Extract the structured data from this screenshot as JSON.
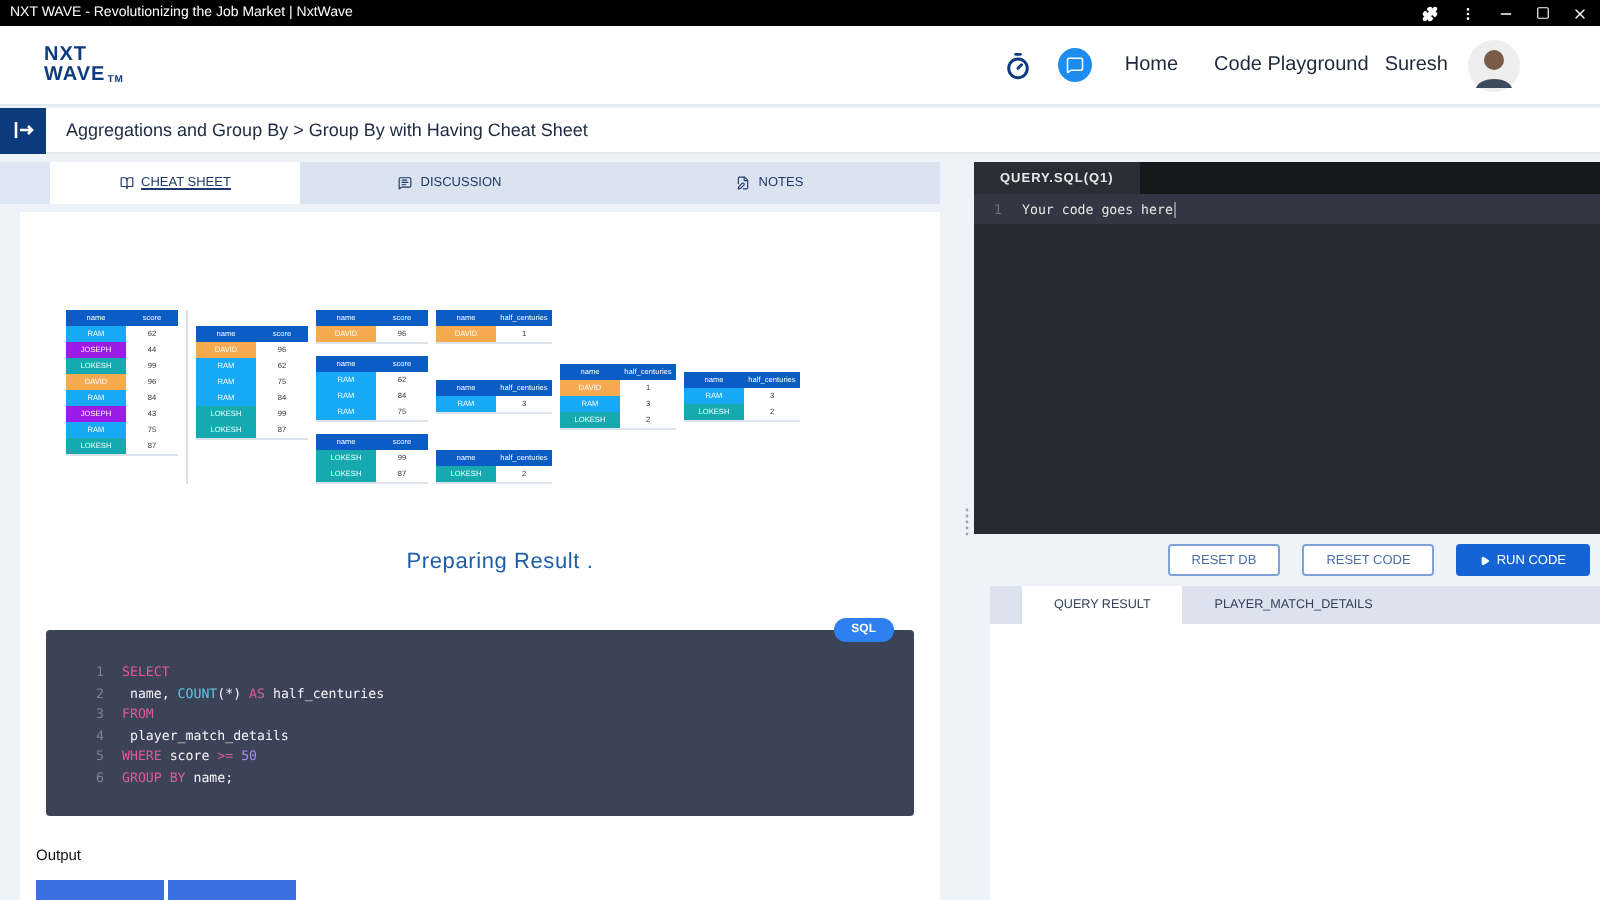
{
  "window": {
    "title": "NXT WAVE - Revolutionizing the Job Market | NxtWave"
  },
  "header": {
    "logo_top": "NXT",
    "logo_bottom": "WAVE",
    "logo_mark": "TM",
    "nav": [
      "Home",
      "Code Playground"
    ],
    "user": "Suresh"
  },
  "breadcrumb": "Aggregations and Group By > Group By with Having Cheat Sheet",
  "tabs": [
    {
      "label": "CHEAT SHEET",
      "selected": true
    },
    {
      "label": "DISCUSSION",
      "selected": false
    },
    {
      "label": "NOTES",
      "selected": false
    }
  ],
  "diagram": {
    "columns": [
      {
        "tables": [
          {
            "headers": [
              "name",
              "score"
            ],
            "rows": [
              {
                "name": "RAM",
                "value": "62",
                "color": "#17a9f5"
              },
              {
                "name": "JOSEPH",
                "value": "44",
                "color": "#9a1ce6"
              },
              {
                "name": "LOKESH",
                "value": "99",
                "color": "#16aab0"
              },
              {
                "name": "DAVID",
                "value": "96",
                "color": "#f6aa4e"
              },
              {
                "name": "RAM",
                "value": "84",
                "color": "#17a9f5"
              },
              {
                "name": "JOSEPH",
                "value": "43",
                "color": "#9a1ce6"
              },
              {
                "name": "RAM",
                "value": "75",
                "color": "#17a9f5"
              },
              {
                "name": "LOKESH",
                "value": "87",
                "color": "#16aab0"
              }
            ]
          }
        ]
      },
      {
        "tables": [
          {
            "headers": [
              "name",
              "score"
            ],
            "rows": [
              {
                "name": "DAVID",
                "value": "96",
                "color": "#f6aa4e"
              },
              {
                "name": "RAM",
                "value": "62",
                "color": "#17a9f5"
              },
              {
                "name": "RAM",
                "value": "75",
                "color": "#17a9f5"
              },
              {
                "name": "RAM",
                "value": "84",
                "color": "#17a9f5"
              },
              {
                "name": "LOKESH",
                "value": "99",
                "color": "#16aab0"
              },
              {
                "name": "LOKESH",
                "value": "87",
                "color": "#16aab0"
              }
            ]
          }
        ]
      },
      {
        "tables": [
          {
            "headers": [
              "name",
              "score"
            ],
            "rows": [
              {
                "name": "DAVID",
                "value": "96",
                "color": "#f6aa4e"
              }
            ]
          },
          {
            "headers": [
              "name",
              "score"
            ],
            "rows": [
              {
                "name": "RAM",
                "value": "62",
                "color": "#17a9f5"
              },
              {
                "name": "RAM",
                "value": "84",
                "color": "#17a9f5"
              },
              {
                "name": "RAM",
                "value": "75",
                "color": "#17a9f5"
              }
            ]
          },
          {
            "headers": [
              "name",
              "score"
            ],
            "rows": [
              {
                "name": "LOKESH",
                "value": "99",
                "color": "#16aab0"
              },
              {
                "name": "LOKESH",
                "value": "87",
                "color": "#16aab0"
              }
            ]
          }
        ]
      },
      {
        "tables": [
          {
            "headers": [
              "name",
              "half_centuries"
            ],
            "rows": [
              {
                "name": "DAVID",
                "value": "1",
                "color": "#f6aa4e"
              }
            ]
          },
          {
            "headers": [
              "name",
              "half_centuries"
            ],
            "rows": [
              {
                "name": "RAM",
                "value": "3",
                "color": "#17a9f5"
              }
            ]
          },
          {
            "headers": [
              "name",
              "half_centuries"
            ],
            "rows": [
              {
                "name": "LOKESH",
                "value": "2",
                "color": "#16aab0"
              }
            ]
          }
        ]
      },
      {
        "tables": [
          {
            "headers": [
              "name",
              "half_centuries"
            ],
            "rows": [
              {
                "name": "DAVID",
                "value": "1",
                "color": "#f6aa4e"
              },
              {
                "name": "RAM",
                "value": "3",
                "color": "#17a9f5"
              },
              {
                "name": "LOKESH",
                "value": "2",
                "color": "#16aab0"
              }
            ]
          }
        ]
      },
      {
        "tables": [
          {
            "headers": [
              "name",
              "half_centuries"
            ],
            "rows": [
              {
                "name": "RAM",
                "value": "3",
                "color": "#17a9f5"
              },
              {
                "name": "LOKESH",
                "value": "2",
                "color": "#16aab0"
              }
            ]
          }
        ]
      }
    ]
  },
  "status": {
    "text": "Preparing Result",
    "dot": "."
  },
  "code_block": {
    "language": "SQL",
    "lines": [
      {
        "number": "1",
        "tokens": [
          {
            "text": "SELECT",
            "kind": "keyword"
          }
        ]
      },
      {
        "number": "2",
        "tokens": [
          {
            "text": " name, ",
            "kind": "plain"
          },
          {
            "text": "COUNT",
            "kind": "function"
          },
          {
            "text": "(*) ",
            "kind": "plain"
          },
          {
            "text": "AS",
            "kind": "keyword"
          },
          {
            "text": " half_centuries",
            "kind": "plain"
          }
        ]
      },
      {
        "number": "3",
        "tokens": [
          {
            "text": "FROM",
            "kind": "keyword"
          }
        ]
      },
      {
        "number": "4",
        "tokens": [
          {
            "text": " player_match_details",
            "kind": "plain"
          }
        ]
      },
      {
        "number": "5",
        "tokens": [
          {
            "text": "WHERE",
            "kind": "keyword"
          },
          {
            "text": " score ",
            "kind": "plain"
          },
          {
            "text": ">=",
            "kind": "keyword"
          },
          {
            "text": " 50",
            "kind": "number"
          }
        ]
      },
      {
        "number": "6",
        "tokens": [
          {
            "text": "GROUP BY",
            "kind": "keyword"
          },
          {
            "text": " name;",
            "kind": "plain"
          }
        ]
      }
    ]
  },
  "output": {
    "label": "Output",
    "header_cells": [
      {
        "kind": "blank"
      },
      {
        "kind": "blank"
      }
    ]
  },
  "editor": {
    "tab": "QUERY.SQL(Q1)",
    "lines": [
      {
        "number": "1",
        "text": "Your code goes here"
      }
    ]
  },
  "buttons": [
    {
      "label": "RESET DB",
      "kind": "outline"
    },
    {
      "label": "RESET CODE",
      "kind": "outline"
    },
    {
      "label": "RUN CODE",
      "kind": "primary"
    }
  ],
  "result_tabs": [
    {
      "label": "QUERY RESULT",
      "selected": true
    },
    {
      "label": "PLAYER_MATCH_DETAILS",
      "selected": false
    }
  ]
}
